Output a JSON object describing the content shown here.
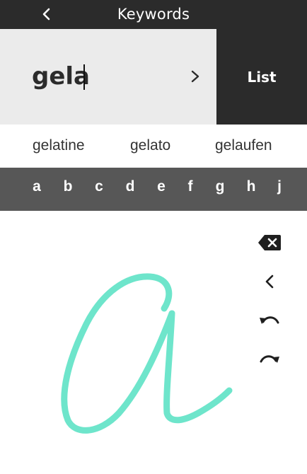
{
  "header": {
    "title": "Keywords",
    "back_icon": "chevron-left-icon"
  },
  "search": {
    "value": "gela",
    "go_icon": "chevron-right-icon",
    "list_label": "List"
  },
  "suggestions": [
    "gelatine",
    "gelato",
    "gelaufen"
  ],
  "letters": [
    "a",
    "b",
    "c",
    "d",
    "e",
    "f",
    "g",
    "h",
    "j"
  ],
  "drawpad": {
    "stroke_color": "#6ee5cb",
    "tools": [
      "backspace-icon",
      "chevron-left-icon",
      "undo-icon",
      "redo-icon"
    ]
  },
  "colors": {
    "dark": "#2b2b2b",
    "input_bg": "#ebebeb",
    "letterbar_bg": "#575757",
    "accent": "#6ee5cb"
  }
}
